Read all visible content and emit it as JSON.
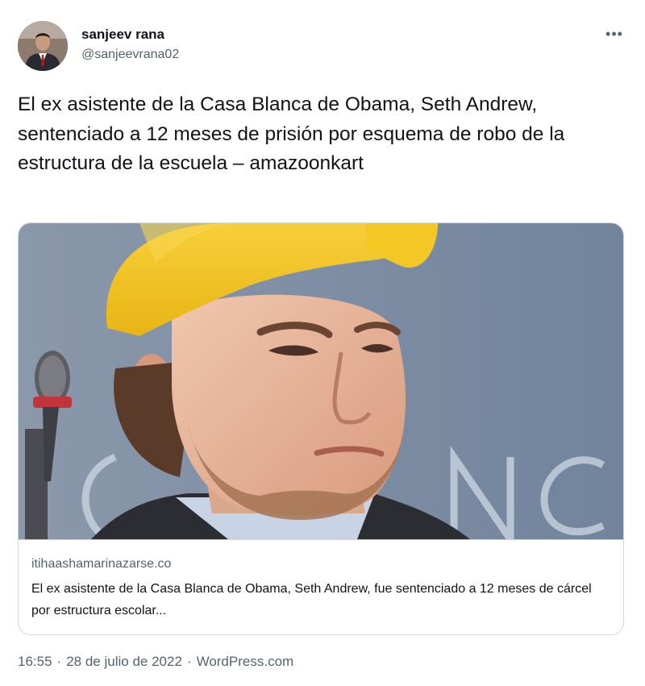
{
  "author": {
    "display_name": "sanjeev rana",
    "handle": "@sanjeevrana02",
    "avatar_icon": "user-avatar"
  },
  "more_icon": "more-horizontal-icon",
  "tweet": {
    "text": "El ex asistente de la Casa Blanca de Obama, Seth Andrew, sentenciado a 12 meses de prisión por esquema de robo de la estructura de la escuela – amazoonkart"
  },
  "card": {
    "domain": "itihaashamarinazarse.co",
    "description": "El ex asistente de la Casa Blanca de Obama, Seth Andrew, fue sentenciado a 12 meses de cárcel por estructura escolar...",
    "image_alt": "Seth Andrew wearing a yellow cap"
  },
  "meta": {
    "time": "16:55",
    "separator": "·",
    "date": "28 de julio de 2022",
    "source": "WordPress.com"
  },
  "colors": {
    "text_primary": "#0f1419",
    "text_secondary": "#536471",
    "border": "#cfd9de",
    "cap_yellow": "#f2c21c",
    "backdrop": "#7e8fa5"
  }
}
